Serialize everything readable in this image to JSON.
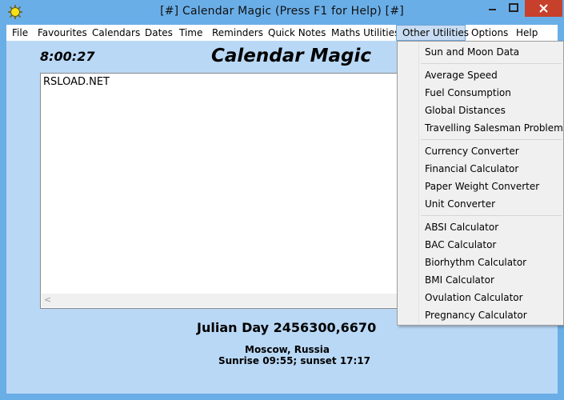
{
  "window": {
    "title": "[#] Calendar Magic (Press F1 for Help) [#]",
    "colors": {
      "frame": "#6aaee8",
      "client": "#b9d8f5",
      "close": "#c7402c",
      "menu_active": "#c8ddf3"
    }
  },
  "menu": {
    "items": [
      {
        "label": "File"
      },
      {
        "label": "Favourites"
      },
      {
        "label": "Calendars"
      },
      {
        "label": "Dates"
      },
      {
        "label": "Time"
      },
      {
        "label": "Reminders"
      },
      {
        "label": "Quick Notes"
      },
      {
        "label": "Maths Utilities"
      },
      {
        "label": "Other Utilities",
        "active": true
      },
      {
        "label": "Options"
      },
      {
        "label": "Help"
      }
    ]
  },
  "main": {
    "clock": "8:00:27",
    "heading": "Calendar Magic",
    "notes_text": "RSLOAD.NET",
    "julian": "Julian Day 2456300,6670",
    "location": "Moscow, Russia",
    "sun_times": "Sunrise 09:55; sunset 17:17"
  },
  "dropdown": {
    "items": [
      "Sun and Moon Data",
      "Average Speed",
      "Fuel Consumption",
      "Global Distances",
      "Travelling Salesman Problem",
      "Currency Converter",
      "Financial Calculator",
      "Paper Weight Converter",
      "Unit Converter",
      "ABSI Calculator",
      "BAC Calculator",
      "Biorhythm Calculator",
      "BMI Calculator",
      "Ovulation Calculator",
      "Pregnancy Calculator"
    ]
  }
}
